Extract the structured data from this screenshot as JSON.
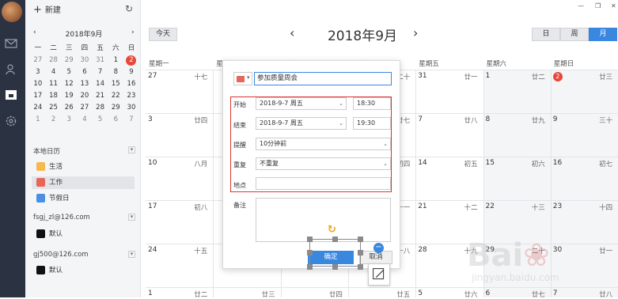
{
  "sidebar": {
    "new_label": "新建",
    "mini_title": "2018年9月",
    "weekdays": [
      "一",
      "二",
      "三",
      "四",
      "五",
      "六",
      "日"
    ],
    "weeks": [
      [
        [
          "27",
          1
        ],
        [
          "28",
          1
        ],
        [
          "29",
          1
        ],
        [
          "30",
          1
        ],
        [
          "31",
          1
        ],
        [
          "1",
          0
        ],
        [
          "2",
          2
        ]
      ],
      [
        [
          "3",
          0
        ],
        [
          "4",
          0
        ],
        [
          "5",
          0
        ],
        [
          "6",
          0
        ],
        [
          "7",
          0
        ],
        [
          "8",
          0
        ],
        [
          "9",
          0
        ]
      ],
      [
        [
          "10",
          0
        ],
        [
          "11",
          0
        ],
        [
          "12",
          0
        ],
        [
          "13",
          0
        ],
        [
          "14",
          0
        ],
        [
          "15",
          0
        ],
        [
          "16",
          0
        ]
      ],
      [
        [
          "17",
          0
        ],
        [
          "18",
          0
        ],
        [
          "19",
          0
        ],
        [
          "20",
          0
        ],
        [
          "21",
          0
        ],
        [
          "22",
          0
        ],
        [
          "23",
          0
        ]
      ],
      [
        [
          "24",
          0
        ],
        [
          "25",
          0
        ],
        [
          "26",
          0
        ],
        [
          "27",
          0
        ],
        [
          "28",
          0
        ],
        [
          "29",
          0
        ],
        [
          "30",
          0
        ]
      ],
      [
        [
          "1",
          1
        ],
        [
          "2",
          1
        ],
        [
          "3",
          1
        ],
        [
          "4",
          1
        ],
        [
          "5",
          1
        ],
        [
          "6",
          1
        ],
        [
          "7",
          1
        ]
      ]
    ],
    "local_section": "本地日历",
    "local_items": [
      {
        "label": "生活",
        "color": "#f5b94d"
      },
      {
        "label": "工作",
        "color": "#e8655a"
      },
      {
        "label": "节假日",
        "color": "#4a90e2"
      }
    ],
    "accounts": [
      {
        "email": "fsgj_zl@126.com",
        "item": "默认"
      },
      {
        "email": "gj500@126.com",
        "item": "默认"
      }
    ]
  },
  "toolbar": {
    "today": "今天",
    "month_title": "2018年9月",
    "views": [
      "日",
      "周",
      "月"
    ]
  },
  "weekday_headers": [
    "星期一",
    "星期二",
    "星期三",
    "星期四",
    "星期五",
    "星期六",
    "星期日"
  ],
  "cells": [
    {
      "d": "27",
      "l": "十七",
      "c": 0,
      "r": 0
    },
    {
      "d": "",
      "l": "",
      "c": 1,
      "r": 0
    },
    {
      "d": "",
      "l": "",
      "c": 2,
      "r": 0
    },
    {
      "d": "",
      "l": "二十",
      "c": 3,
      "r": 0
    },
    {
      "d": "31",
      "l": "廿一",
      "c": 4,
      "r": 0
    },
    {
      "d": "1",
      "l": "廿二",
      "c": 5,
      "r": 0
    },
    {
      "d": "2",
      "l": "廿三",
      "c": 6,
      "r": 0
    },
    {
      "d": "3",
      "l": "廿四",
      "c": 0,
      "r": 1
    },
    {
      "d": "",
      "l": "",
      "c": 1,
      "r": 1
    },
    {
      "d": "",
      "l": "",
      "c": 2,
      "r": 1
    },
    {
      "d": "",
      "l": "廿七",
      "c": 3,
      "r": 1
    },
    {
      "d": "7",
      "l": "廿八",
      "c": 4,
      "r": 1
    },
    {
      "d": "8",
      "l": "廿九",
      "c": 5,
      "r": 1
    },
    {
      "d": "9",
      "l": "三十",
      "c": 6,
      "r": 1
    },
    {
      "d": "10",
      "l": "八月",
      "c": 0,
      "r": 2
    },
    {
      "d": "",
      "l": "",
      "c": 1,
      "r": 2
    },
    {
      "d": "",
      "l": "",
      "c": 2,
      "r": 2
    },
    {
      "d": "",
      "l": "初四",
      "c": 3,
      "r": 2
    },
    {
      "d": "14",
      "l": "初五",
      "c": 4,
      "r": 2
    },
    {
      "d": "15",
      "l": "初六",
      "c": 5,
      "r": 2
    },
    {
      "d": "16",
      "l": "初七",
      "c": 6,
      "r": 2
    },
    {
      "d": "17",
      "l": "初八",
      "c": 0,
      "r": 3
    },
    {
      "d": "",
      "l": "",
      "c": 1,
      "r": 3
    },
    {
      "d": "",
      "l": "",
      "c": 2,
      "r": 3
    },
    {
      "d": "",
      "l": "十一",
      "c": 3,
      "r": 3
    },
    {
      "d": "21",
      "l": "十二",
      "c": 4,
      "r": 3
    },
    {
      "d": "22",
      "l": "十三",
      "c": 5,
      "r": 3
    },
    {
      "d": "23",
      "l": "十四",
      "c": 6,
      "r": 3
    },
    {
      "d": "24",
      "l": "十五",
      "c": 0,
      "r": 4
    },
    {
      "d": "",
      "l": "",
      "c": 1,
      "r": 4
    },
    {
      "d": "",
      "l": "",
      "c": 2,
      "r": 4
    },
    {
      "d": "",
      "l": "十八",
      "c": 3,
      "r": 4
    },
    {
      "d": "28",
      "l": "十九",
      "c": 4,
      "r": 4
    },
    {
      "d": "29",
      "l": "二十",
      "c": 5,
      "r": 4
    },
    {
      "d": "30",
      "l": "廿一",
      "c": 6,
      "r": 4
    },
    {
      "d": "1",
      "l": "廿二",
      "c": 0,
      "r": 5
    },
    {
      "d": "",
      "l": "廿三",
      "c": 1,
      "r": 5
    },
    {
      "d": "",
      "l": "廿四",
      "c": 2,
      "r": 5
    },
    {
      "d": "",
      "l": "廿五",
      "c": 3,
      "r": 5
    },
    {
      "d": "5",
      "l": "廿六",
      "c": 4,
      "r": 5
    },
    {
      "d": "6",
      "l": "廿七",
      "c": 5,
      "r": 5
    },
    {
      "d": "7",
      "l": "廿八",
      "c": 6,
      "r": 5
    }
  ],
  "event_panel": {
    "title_value": "参加质量周会",
    "start_label": "开始",
    "start_date": "2018-9-7 周五",
    "start_time": "18:30",
    "end_label": "结束",
    "end_date": "2018-9-7 周五",
    "end_time": "19:30",
    "remind_label": "提醒",
    "remind_value": "10分钟前",
    "repeat_label": "重复",
    "repeat_value": "不重复",
    "location_label": "地点",
    "note_label": "备注",
    "ok_label": "确定",
    "cancel_label": "取消"
  },
  "colors": {
    "accent": "#3a87e0",
    "today": "#e8483a",
    "highlight_box": "#dd3333"
  },
  "watermark": {
    "text": "Baidu 经验",
    "url": "jingyan.baidu.com"
  }
}
